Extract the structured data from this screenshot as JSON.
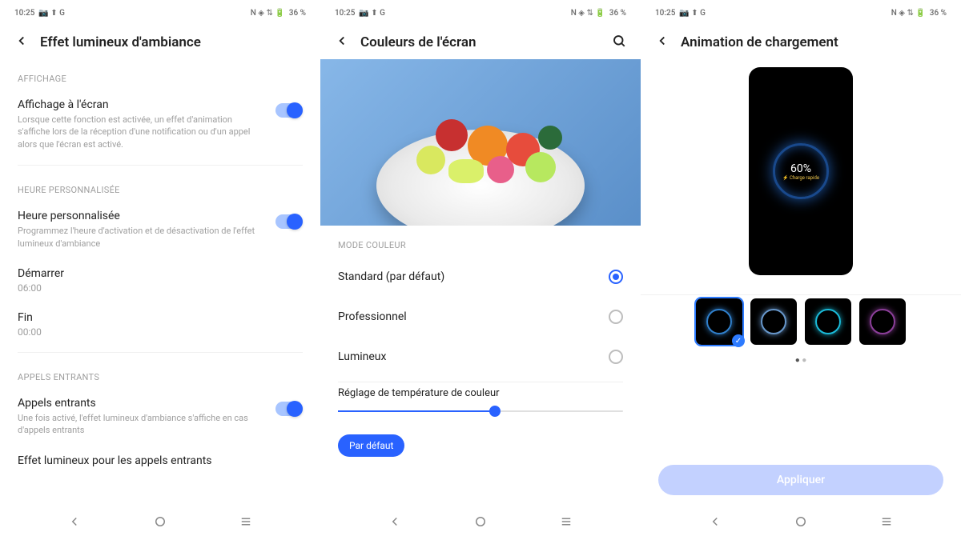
{
  "status": {
    "time": "10:25",
    "battery": "36 %",
    "icons_left": "📷 ⬆ G",
    "icons_right": "N ◈ ⇅ 🔋"
  },
  "s1": {
    "title": "Effet lumineux d'ambiance",
    "sect1": "AFFICHAGE",
    "row1_title": "Affichage à l'écran",
    "row1_desc": "Lorsque cette fonction est activée, un effet d'animation s'affiche lors de la réception d'une notification ou d'un appel alors que l'écran est activé.",
    "sect2": "HEURE PERSONNALISÉE",
    "row2_title": "Heure personnalisée",
    "row2_desc": "Programmez l'heure d'activation et de désactivation de l'effet lumineux d'ambiance",
    "row3_title": "Démarrer",
    "row3_val": "06:00",
    "row4_title": "Fin",
    "row4_val": "00:00",
    "sect3": "APPELS ENTRANTS",
    "row5_title": "Appels entrants",
    "row5_desc": "Une fois activé, l'effet lumineux d'ambiance s'affiche en cas d'appels entrants",
    "row6_title": "Effet lumineux pour les appels entrants"
  },
  "s2": {
    "title": "Couleurs de l'écran",
    "sect": "MODE COULEUR",
    "opt1": "Standard (par défaut)",
    "opt2": "Professionnel",
    "opt3": "Lumineux",
    "slider_label": "Réglage de température de couleur",
    "btn": "Par défaut"
  },
  "s3": {
    "title": "Animation de chargement",
    "percent": "60%",
    "sub": "⚡ Charge rapide",
    "apply": "Appliquer"
  }
}
